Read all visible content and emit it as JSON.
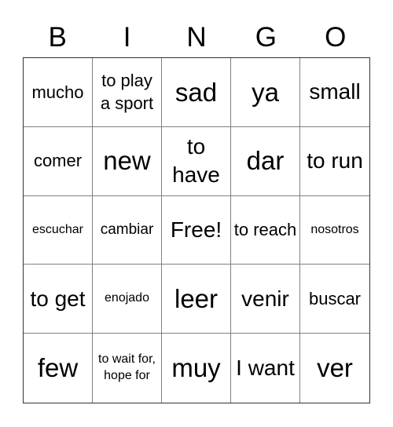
{
  "header": {
    "letters": [
      "B",
      "I",
      "N",
      "G",
      "O"
    ]
  },
  "board": {
    "rows": [
      [
        {
          "text": "mucho",
          "size": "m"
        },
        {
          "text": "to play a sport",
          "size": "m"
        },
        {
          "text": "sad",
          "size": "xl"
        },
        {
          "text": "ya",
          "size": "xl"
        },
        {
          "text": "small",
          "size": "l"
        }
      ],
      [
        {
          "text": "comer",
          "size": "m"
        },
        {
          "text": "new",
          "size": "xl"
        },
        {
          "text": "to have",
          "size": "l"
        },
        {
          "text": "dar",
          "size": "xl"
        },
        {
          "text": "to run",
          "size": "l"
        }
      ],
      [
        {
          "text": "escuchar",
          "size": "xs"
        },
        {
          "text": "cambiar",
          "size": "s"
        },
        {
          "text": "Free!",
          "size": "l"
        },
        {
          "text": "to reach",
          "size": "m"
        },
        {
          "text": "nosotros",
          "size": "xs"
        }
      ],
      [
        {
          "text": "to get",
          "size": "l"
        },
        {
          "text": "enojado",
          "size": "xs"
        },
        {
          "text": "leer",
          "size": "xl"
        },
        {
          "text": "venir",
          "size": "l"
        },
        {
          "text": "buscar",
          "size": "m"
        }
      ],
      [
        {
          "text": "few",
          "size": "xl"
        },
        {
          "text": "to wait for, hope for",
          "size": "xs"
        },
        {
          "text": "muy",
          "size": "xl"
        },
        {
          "text": "I want",
          "size": "l"
        },
        {
          "text": "ver",
          "size": "xl"
        }
      ]
    ]
  }
}
